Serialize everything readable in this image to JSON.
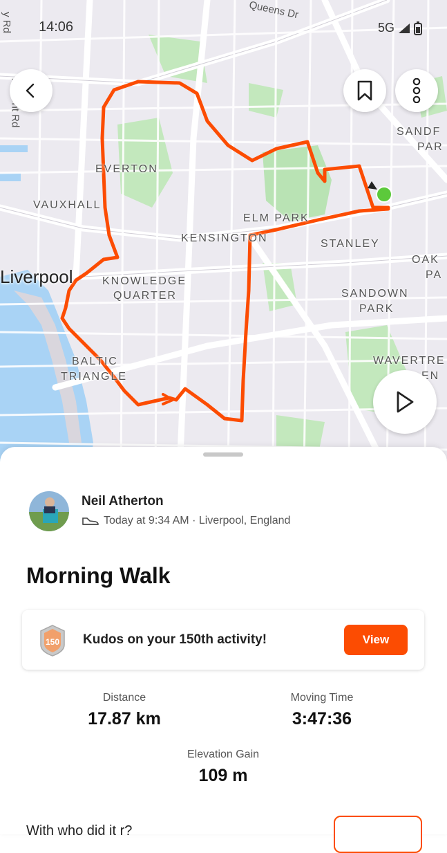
{
  "status_bar": {
    "time": "14:06",
    "network": "5G"
  },
  "map": {
    "labels": {
      "everton": "EVERTON",
      "vauxhall": "VAUXHALL",
      "elm_park": "ELM PARK",
      "kensington": "KENSINGTON",
      "stanley": "STANLEY",
      "oak": "OAK",
      "pa": "PA",
      "knowledge": "KNOWLEDGE",
      "quarter": "QUARTER",
      "sandown": "SANDOWN",
      "park": "PARK",
      "baltic": "BALTIC",
      "triangle": "TRIANGLE",
      "wavertre": "WAVERTRE",
      "en": "EN",
      "sandf": "SANDF",
      "par": "PAR",
      "city": "Liverpool",
      "queens_dr": "Queens Dr",
      "regent_rd": "Regent Rd",
      "y_rd": "y Rd"
    },
    "route_color": "#fc4c02",
    "start_marker_color": "#5cc93b"
  },
  "controls": {
    "back_icon": "chevron-left-icon",
    "bookmark_icon": "bookmark-icon",
    "more_icon": "more-vertical-icon",
    "play_icon": "play-icon"
  },
  "activity": {
    "athlete": "Neil Atherton",
    "meta": "Today at 9:34 AM · Liverpool, England",
    "title": "Morning Walk",
    "kudos_text": "Kudos on your 150th activity!",
    "kudos_badge": "150",
    "view_label": "View",
    "stats": {
      "distance_label": "Distance",
      "distance_value": "17.87 km",
      "time_label": "Moving Time",
      "time_value": "3:47:36",
      "elevation_label": "Elevation Gain",
      "elevation_value": "109 m"
    },
    "bottom_text": "With                    who did it      r?"
  }
}
